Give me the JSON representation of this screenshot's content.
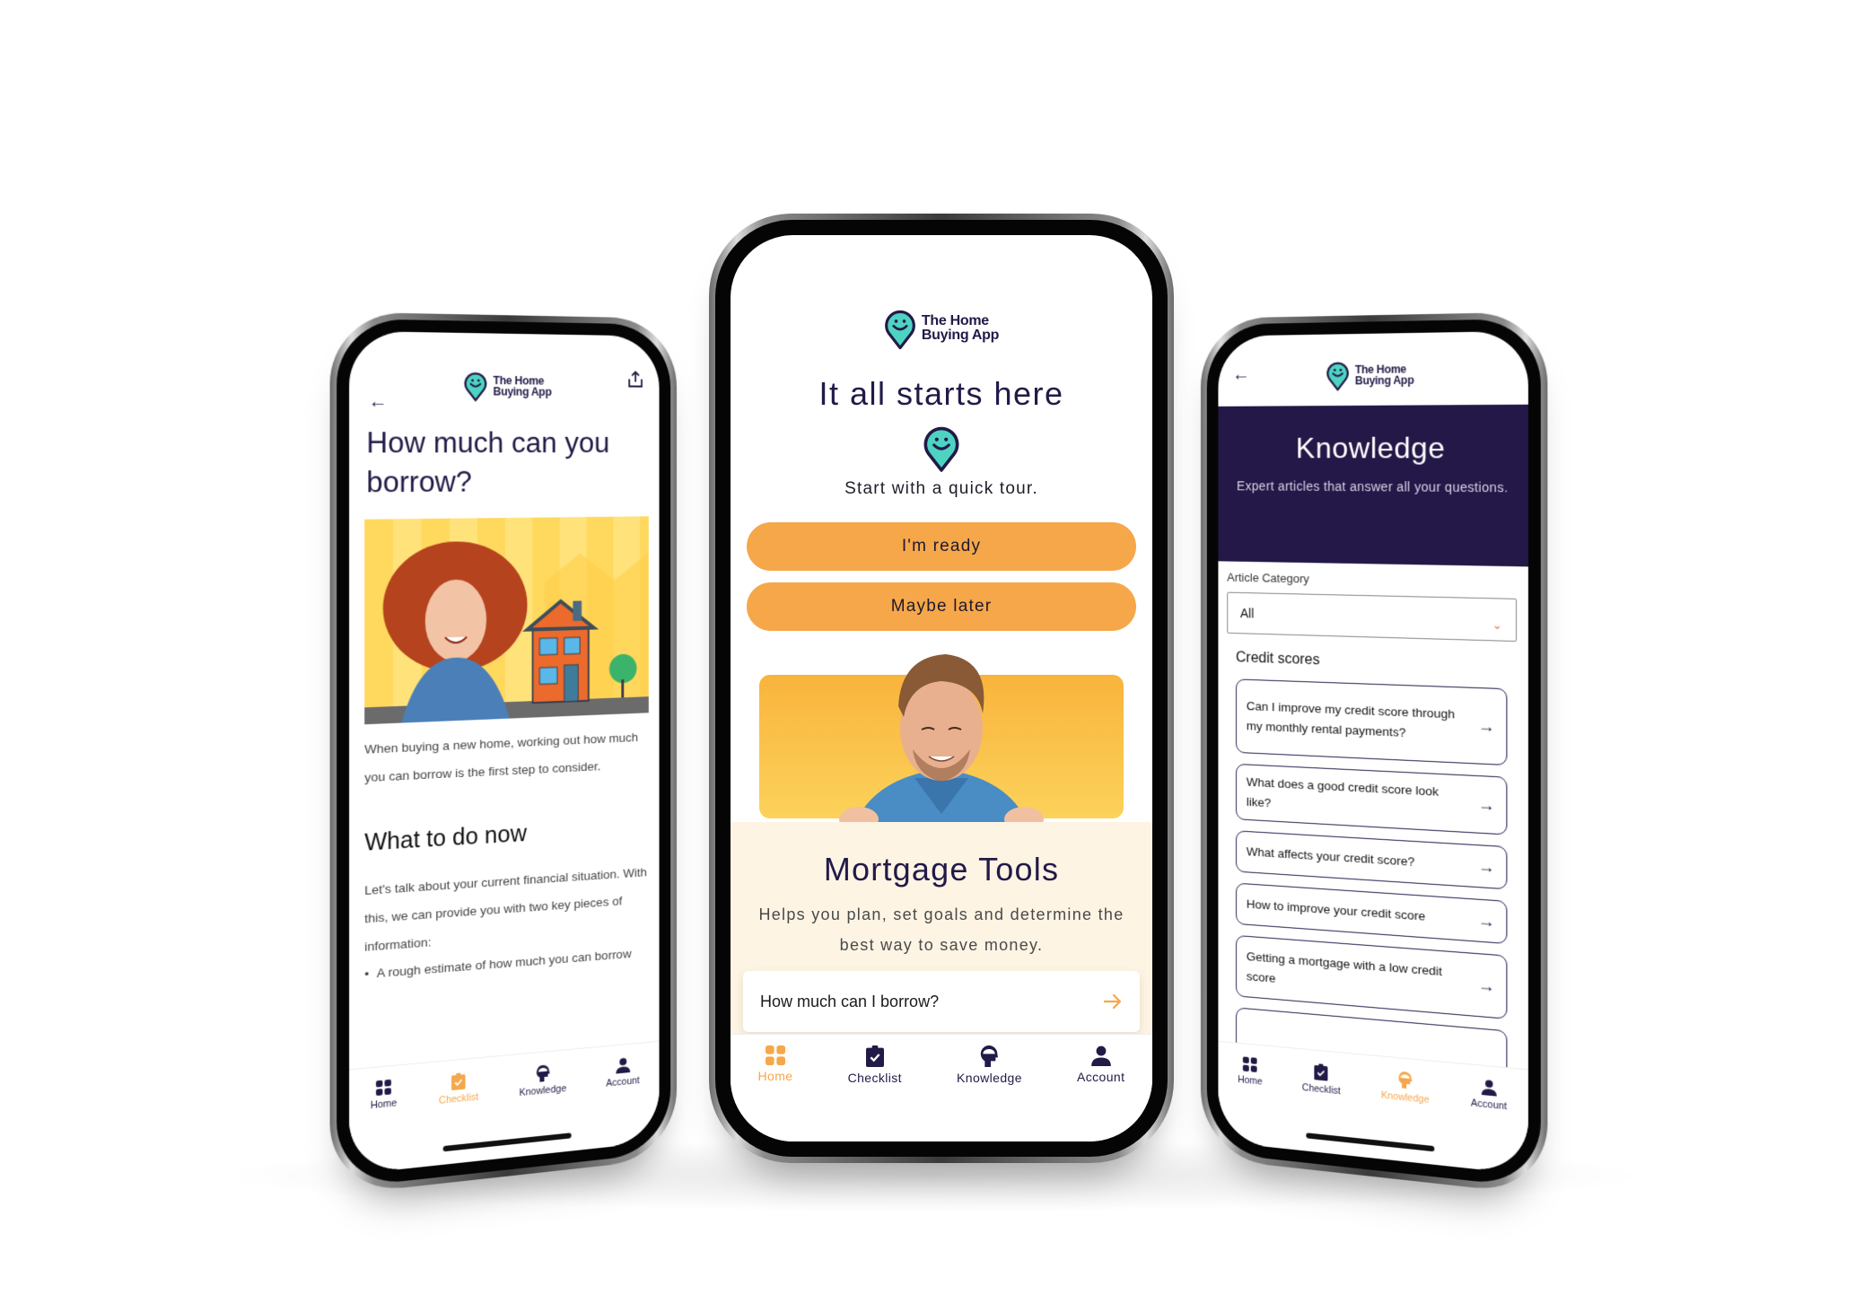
{
  "brand": {
    "logo_line1": "The Home",
    "logo_line2": "Buying App",
    "colors": {
      "primary": "#221a47",
      "accent": "#f6a74a",
      "pin": "#4ed3c2",
      "tools_bg": "#fdf4e4",
      "banner": "#241848"
    }
  },
  "tabs": [
    {
      "label": "Home",
      "icon": "grid-icon"
    },
    {
      "label": "Checklist",
      "icon": "clipboard-check-icon"
    },
    {
      "label": "Knowledge",
      "icon": "head-icon"
    },
    {
      "label": "Account",
      "icon": "person-icon"
    }
  ],
  "center": {
    "title": "It all starts here",
    "subtitle": "Start with a quick tour.",
    "btn_ready": "I'm ready",
    "btn_later": "Maybe later",
    "tools_title": "Mortgage Tools",
    "tools_desc": "Helps you plan, set goals and determine the best way to save money.",
    "tool_cards": [
      "How much can I borrow?",
      ""
    ],
    "active_tab": "Home"
  },
  "left": {
    "title": "How much can you borrow?",
    "intro": "When buying a new home, working out how much you can borrow is the first step to consider.",
    "heading": "What to do now",
    "body": "Let's talk about your current financial situation. With this, we can provide you with two key pieces of information:",
    "bullets": [
      "A rough estimate of how much you can borrow"
    ],
    "active_tab": "Checklist"
  },
  "right": {
    "title": "Knowledge",
    "subtitle": "Expert articles that answer all your questions.",
    "category_label": "Article Category",
    "category_value": "All",
    "section": "Credit scores",
    "articles": [
      "Can I improve my credit score through my monthly rental payments?",
      "What does a good credit score look like?",
      "What affects your credit score?",
      "How to improve your credit score",
      "Getting a mortgage with a low credit score"
    ],
    "active_tab": "Knowledge"
  }
}
